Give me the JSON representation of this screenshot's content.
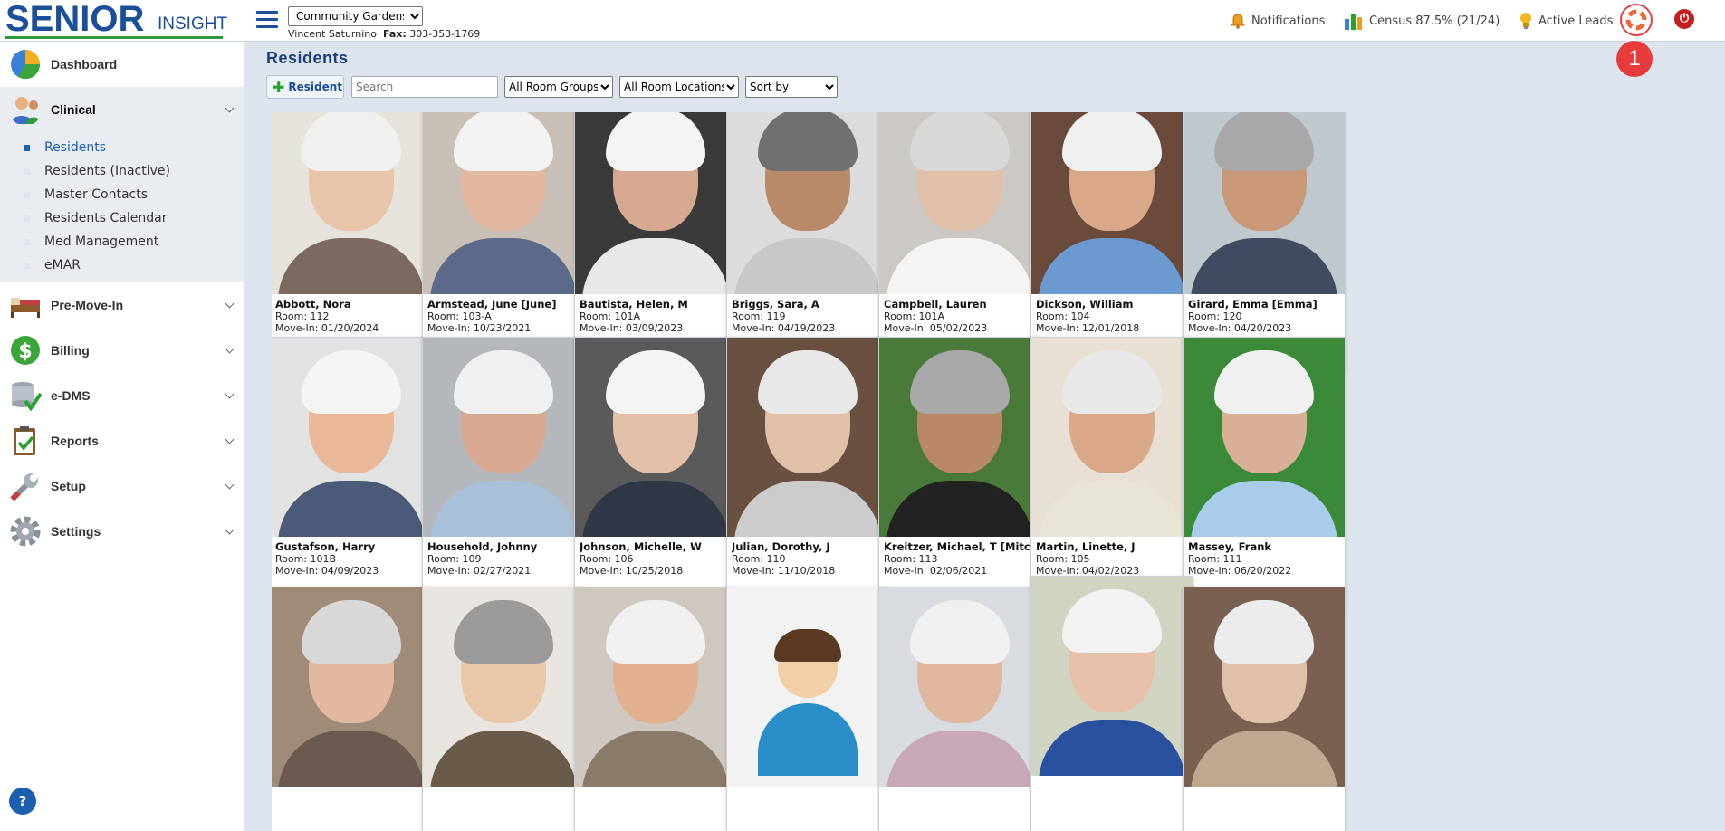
{
  "app": {
    "logo_brand": "SENIOR",
    "logo_sub": "INSIGHT",
    "community_options": [
      "Community Gardens"
    ],
    "community_selected": "Community Gardens",
    "user_name": "Vincent Saturnino",
    "fax_label": "Fax:",
    "fax_number": "303-353-1769",
    "notifications_label": "Notifications",
    "census_label": "Census 87.5% (21/24)",
    "active_leads_label": "Active Leads",
    "annotation_badge": "1"
  },
  "sidebar": {
    "items": [
      {
        "label": "Dashboard",
        "icon": "dashboard-pie-icon"
      },
      {
        "label": "Clinical",
        "icon": "clinical-user-icon"
      },
      {
        "label": "Pre-Move-In",
        "icon": "bed-icon"
      },
      {
        "label": "Billing",
        "icon": "dollar-icon"
      },
      {
        "label": "e-DMS",
        "icon": "database-check-icon"
      },
      {
        "label": "Reports",
        "icon": "clipboard-check-icon"
      },
      {
        "label": "Setup",
        "icon": "wrench-icon"
      },
      {
        "label": "Settings",
        "icon": "gear-icon"
      }
    ],
    "clinical_sub": [
      "Residents",
      "Residents (Inactive)",
      "Master Contacts",
      "Residents Calendar",
      "Med Management",
      "eMAR"
    ],
    "help_label": "?"
  },
  "main": {
    "title": "Residents",
    "add_button": "Resident",
    "search_placeholder": "Search",
    "room_groups": "All Room Groups",
    "room_locations": "All Room Locations",
    "sort_by": "Sort by"
  },
  "residents": [
    {
      "name": "Abbott, Nora",
      "room": "Room: 112",
      "move_in": "Move-In: 01/20/2024"
    },
    {
      "name": "Armstead, June [June]",
      "room": "Room: 103-A",
      "move_in": "Move-In: 10/23/2021"
    },
    {
      "name": "Bautista, Helen, M",
      "room": "Room: 101A",
      "move_in": "Move-In: 03/09/2023"
    },
    {
      "name": "Briggs, Sara, A",
      "room": "Room: 119",
      "move_in": "Move-In: 04/19/2023"
    },
    {
      "name": "Campbell, Lauren",
      "room": "Room: 101A",
      "move_in": "Move-In: 05/02/2023"
    },
    {
      "name": "Dickson, William",
      "room": "Room: 104",
      "move_in": "Move-In: 12/01/2018"
    },
    {
      "name": "Girard, Emma [Emma]",
      "room": "Room: 120",
      "move_in": "Move-In: 04/20/2023"
    },
    {
      "name": "Gustafson, Harry",
      "room": "Room: 101B",
      "move_in": "Move-In: 04/09/2023"
    },
    {
      "name": "Household, Johnny",
      "room": "Room: 109",
      "move_in": "Move-In: 02/27/2021"
    },
    {
      "name": "Johnson, Michelle, W",
      "room": "Room: 106",
      "move_in": "Move-In: 10/25/2018"
    },
    {
      "name": "Julian, Dorothy, J",
      "room": "Room: 110",
      "move_in": "Move-In: 11/10/2018"
    },
    {
      "name": "Kreitzer, Michael, T [Mitch]",
      "room": "Room: 113",
      "move_in": "Move-In: 02/06/2021"
    },
    {
      "name": "Martin, Linette, J",
      "room": "Room: 105",
      "move_in": "Move-In: 04/02/2023"
    },
    {
      "name": "Massey, Frank",
      "room": "Room: 111",
      "move_in": "Move-In: 06/20/2022"
    }
  ],
  "colors": {
    "brand_blue": "#1b4f9a",
    "accent_green": "#2a9a3a",
    "alert_red": "#e83b3b"
  }
}
